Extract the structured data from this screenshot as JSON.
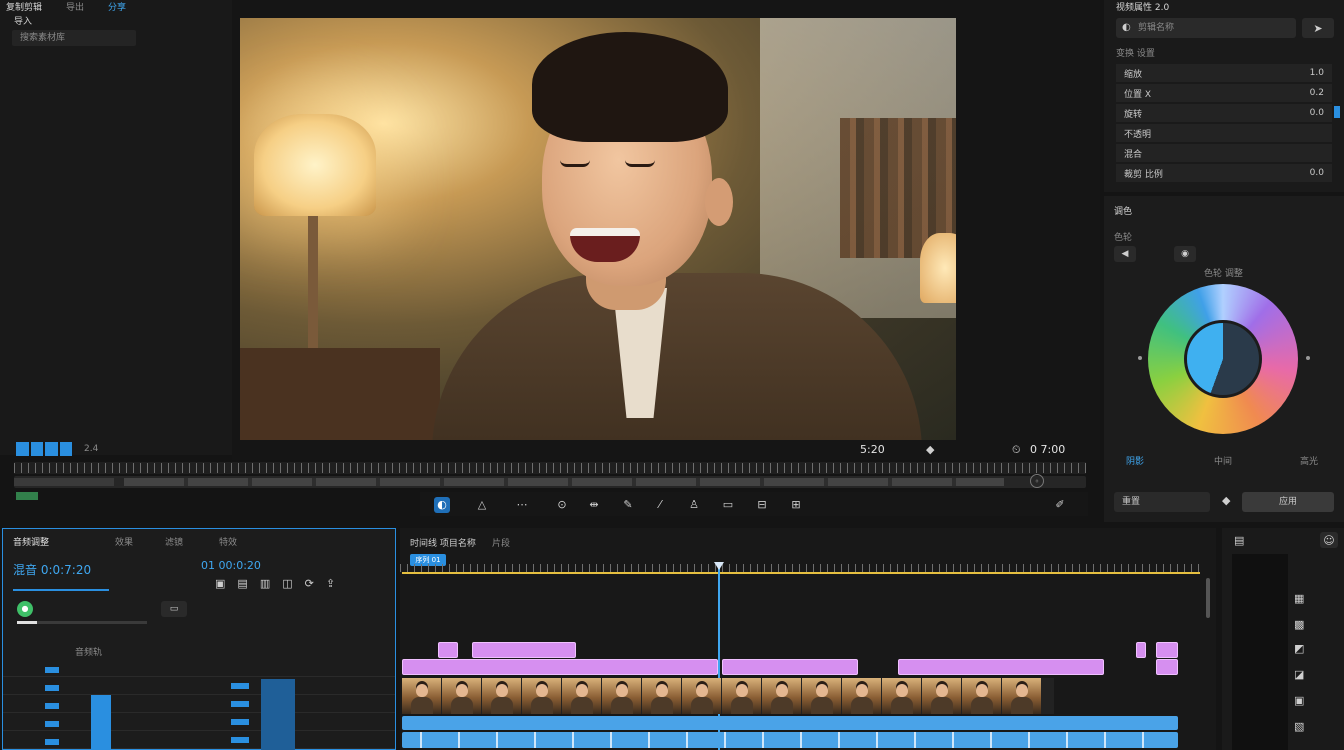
{
  "app": {
    "menu": [
      "复制剪辑",
      "导出",
      "分享"
    ],
    "search_label": "搜索素材库",
    "sub_label": "导入"
  },
  "viewer": {
    "timecode": "5:20",
    "right_timecode": "0 7:00",
    "speed": "2.4"
  },
  "inspector": {
    "header": "视频属性 2.0",
    "field_label": "剪辑名称",
    "section": "变换 设置",
    "rows": [
      {
        "label": "缩放",
        "value": "1.0"
      },
      {
        "label": "位置 X",
        "value": "0.2"
      },
      {
        "label": "旋转",
        "value": "0.0"
      },
      {
        "label": "不透明",
        "value": ""
      },
      {
        "label": "混合",
        "value": ""
      },
      {
        "label": "裁剪 比例",
        "value": "0.0"
      }
    ],
    "color_section": "调色",
    "color_sub": "色轮",
    "wheel_label": "色轮 调整",
    "wheel_labels": [
      "阴影",
      "中间",
      "高光"
    ],
    "reset_label": "重置",
    "apply_label": "应用"
  },
  "left_panel": {
    "title": "音频调整",
    "tabs": [
      "效果",
      "滤镜",
      "特效"
    ],
    "timecode": "混音 0:0:7:20",
    "sub_timecode": "01 00:0:20",
    "track_label": "音频轨"
  },
  "timeline": {
    "tabs": [
      "时间线 项目名称",
      "片段"
    ],
    "active_label": "序列 01"
  },
  "colors": {
    "accent": "#3fa7f0",
    "clip_purple": "#d68ff0",
    "clip_blue": "#4aa3e8",
    "playhead": "#3fa7f0",
    "ruler": "#e6c040"
  }
}
